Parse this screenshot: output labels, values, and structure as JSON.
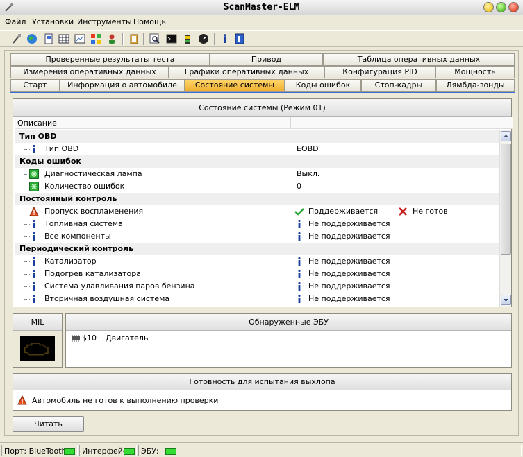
{
  "window": {
    "title": "ScanMaster-ELM"
  },
  "menu": [
    "Файл",
    "Установки",
    "Инструменты",
    "Помощь"
  ],
  "tabs": {
    "row1": [
      "Проверенные результаты теста",
      "Привод",
      "Таблица оперативных данных"
    ],
    "row2": [
      "Измерения оперативных данных",
      "Графики оперативных данных",
      "Конфигурация PID",
      "Мощность"
    ],
    "row3": [
      "Старт",
      "Информация о автомобиле",
      "Состояние системы",
      "Коды ошибок",
      "Стоп-кадры",
      "Лямбда-зонды"
    ],
    "active": "Состояние системы"
  },
  "status_panel": {
    "title": "Состояние системы (Режим 01)",
    "column_description": "Описание",
    "rows": [
      {
        "type": "group",
        "label": "Тип OBD"
      },
      {
        "type": "item",
        "icon": "info-icon",
        "label": "Тип OBD",
        "value": "EOBD"
      },
      {
        "type": "group",
        "label": "Коды ошибок"
      },
      {
        "type": "item",
        "icon": "green-status-icon",
        "label": "Диагностическая лампа",
        "value": "Выкл."
      },
      {
        "type": "item",
        "icon": "green-status-icon",
        "label": "Количество ошибок",
        "value": "0"
      },
      {
        "type": "group",
        "label": "Постоянный контроль"
      },
      {
        "type": "item",
        "icon": "warning-icon",
        "label": "Пропуск воспламенения",
        "value_icon": "check-icon",
        "value": "Поддерживается",
        "status_icon": "cross-icon",
        "status": "Не готов"
      },
      {
        "type": "item",
        "icon": "info-icon",
        "label": "Топливная система",
        "value_icon": "info-icon",
        "value": "Не поддерживается"
      },
      {
        "type": "item",
        "icon": "info-icon",
        "label": "Все компоненты",
        "value_icon": "info-icon",
        "value": "Не поддерживается"
      },
      {
        "type": "group",
        "label": "Периодический контроль"
      },
      {
        "type": "item",
        "icon": "info-icon",
        "label": "Катализатор",
        "value_icon": "info-icon",
        "value": "Не поддерживается"
      },
      {
        "type": "item",
        "icon": "info-icon",
        "label": "Подогрев катализатора",
        "value_icon": "info-icon",
        "value": "Не поддерживается"
      },
      {
        "type": "item",
        "icon": "info-icon",
        "label": "Система улавливания паров бензина",
        "value_icon": "info-icon",
        "value": "Не поддерживается"
      },
      {
        "type": "item",
        "icon": "info-icon",
        "label": "Вторичная воздушная система",
        "value_icon": "info-icon",
        "value": "Не поддерживается"
      }
    ]
  },
  "mil": {
    "title": "MIL"
  },
  "ecu_panel": {
    "title": "Обнаруженные ЭБУ",
    "items": [
      {
        "id": "$10",
        "name": "Двигатель"
      }
    ]
  },
  "readiness": {
    "title": "Готовность для испытания выхлопа",
    "message": "Автомобиль не готов к выполнению проверки"
  },
  "read_button": "Читать",
  "statusbar": {
    "port_label": "Порт: BlueTooth",
    "interface_label": "Интерфейс:",
    "ecu_label": "ЭБУ:",
    "led_color": "#33dd33"
  }
}
